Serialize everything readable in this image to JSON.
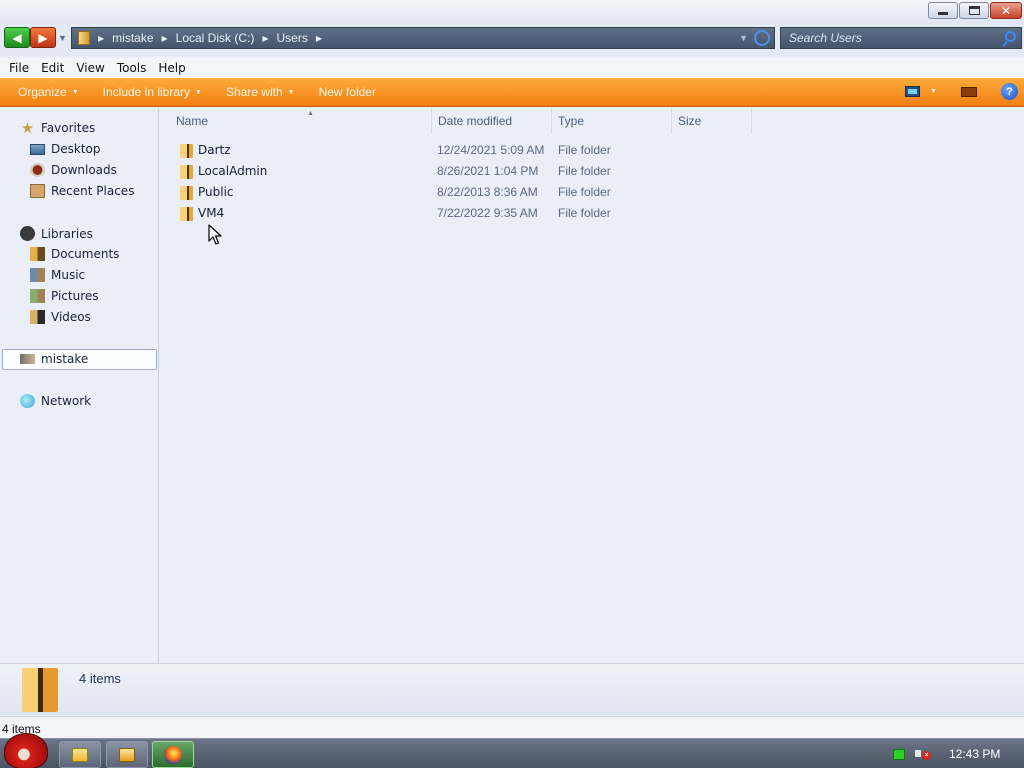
{
  "address": {
    "crumbs": [
      "mistake",
      "Local Disk (C:)",
      "Users"
    ]
  },
  "search": {
    "placeholder": "Search Users"
  },
  "menu": [
    "File",
    "Edit",
    "View",
    "Tools",
    "Help"
  ],
  "toolbar": {
    "organize": "Organize",
    "include_in_library": "Include in library",
    "share_with": "Share with",
    "new_folder": "New folder"
  },
  "nav": {
    "favorites": "Favorites",
    "favorites_items": [
      "Desktop",
      "Downloads",
      "Recent Places"
    ],
    "libraries": "Libraries",
    "libraries_items": [
      "Documents",
      "Music",
      "Pictures",
      "Videos"
    ],
    "computer": "mistake",
    "network": "Network"
  },
  "columns": {
    "name": "Name",
    "date": "Date modified",
    "type": "Type",
    "size": "Size"
  },
  "files": [
    {
      "name": "Dartz",
      "date": "12/24/2021 5:09 AM",
      "type": "File folder"
    },
    {
      "name": "LocalAdmin",
      "date": "8/26/2021 1:04 PM",
      "type": "File folder"
    },
    {
      "name": "Public",
      "date": "8/22/2013 8:36 AM",
      "type": "File folder"
    },
    {
      "name": "VM4",
      "date": "7/22/2022 9:35 AM",
      "type": "File folder"
    }
  ],
  "details": {
    "count": "4 items"
  },
  "status": {
    "text": "4 items"
  },
  "taskbar": {
    "clock": "12:43 PM"
  }
}
